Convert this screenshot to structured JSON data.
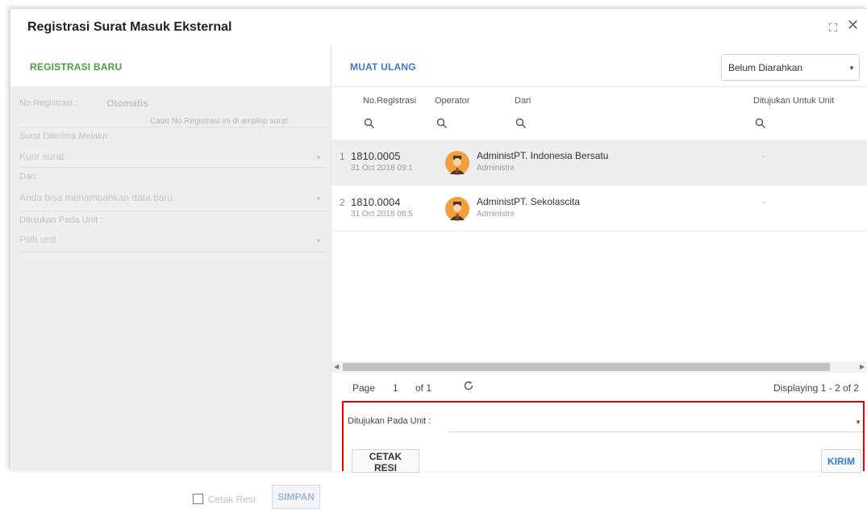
{
  "window": {
    "title": "Registrasi Surat Masuk Eksternal",
    "maximize_icon": "maximize-icon",
    "close_icon": "close-icon"
  },
  "left": {
    "register_button": "REGISTRASI BARU",
    "form": {
      "no_registrasi_label": "No.Registrasi :",
      "no_registrasi_value": "Otomatis",
      "no_registrasi_hint": "Catat No.Registrasi ini di amplop surat",
      "diterima_label": "Surat Diterima Melalui:",
      "diterima_value": "Kurir surat",
      "dari_label": "Dari:",
      "dari_placeholder": "Anda bisa menambahkan data baru",
      "unit_label": "Ditujukan Pada Unit :",
      "unit_placeholder": "Pilih unit"
    },
    "cetak_resi_checkbox_label": "Cetak Resi",
    "save_button": "SIMPAN"
  },
  "right": {
    "reload_button": "MUAT ULANG",
    "filter_value": "Belum Diarahkan",
    "columns": [
      "No.Registrasi",
      "Operator",
      "Dari",
      "Ditujukan Untuk Unit"
    ],
    "rows": [
      {
        "num": "1",
        "reg_no": "1810.0005",
        "date": "31 Oct 2018 09:1",
        "operator_name": "Administr",
        "operator_role": "Administra",
        "dari": "PT. Indonesia Bersatu",
        "unit": "-",
        "selected": true
      },
      {
        "num": "2",
        "reg_no": "1810.0004",
        "date": "31 Oct 2018 08:5",
        "operator_name": "Administr",
        "operator_role": "Administra",
        "dari": "PT. Sekolascita",
        "unit": "-",
        "selected": false
      }
    ],
    "pager": {
      "page_label": "Page",
      "page_value": "1",
      "of_label": "of 1",
      "displaying": "Displaying 1 - 2 of 2"
    },
    "action": {
      "unit_label": "Ditujukan Pada Unit :",
      "cetak_button": "CETAK RESI",
      "kirim_button": "KIRIM"
    }
  },
  "colors": {
    "register_green": "#4e9d3a",
    "link_blue": "#3c7bc9",
    "highlight_red": "#e00000",
    "avatar_orange": "#f2a03d"
  }
}
